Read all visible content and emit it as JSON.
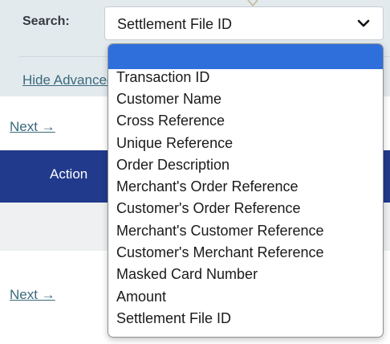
{
  "search": {
    "label": "Search:",
    "selected_value": "Settlement File ID",
    "options": [
      "",
      "Transaction ID",
      "Customer Name",
      "Cross Reference",
      "Unique Reference",
      "Order Description",
      "Merchant's Order Reference",
      "Customer's Order Reference",
      "Merchant's Customer Reference",
      "Customer's Merchant Reference",
      "Masked Card Number",
      "Amount",
      "Settlement File ID"
    ],
    "highlighted_index": 0,
    "highlight_color": "#2f6fdc"
  },
  "links": {
    "hide_advanced": "Hide Advanced",
    "next_top": "Next →",
    "next_bottom": "Next →"
  },
  "table": {
    "header_color": "#223a8c",
    "action_header": "Action"
  },
  "colors": {
    "panel_background": "#e3eaee",
    "link": "#3a6a7c"
  },
  "icons": {
    "select_arrow": "chevron-down-icon"
  }
}
